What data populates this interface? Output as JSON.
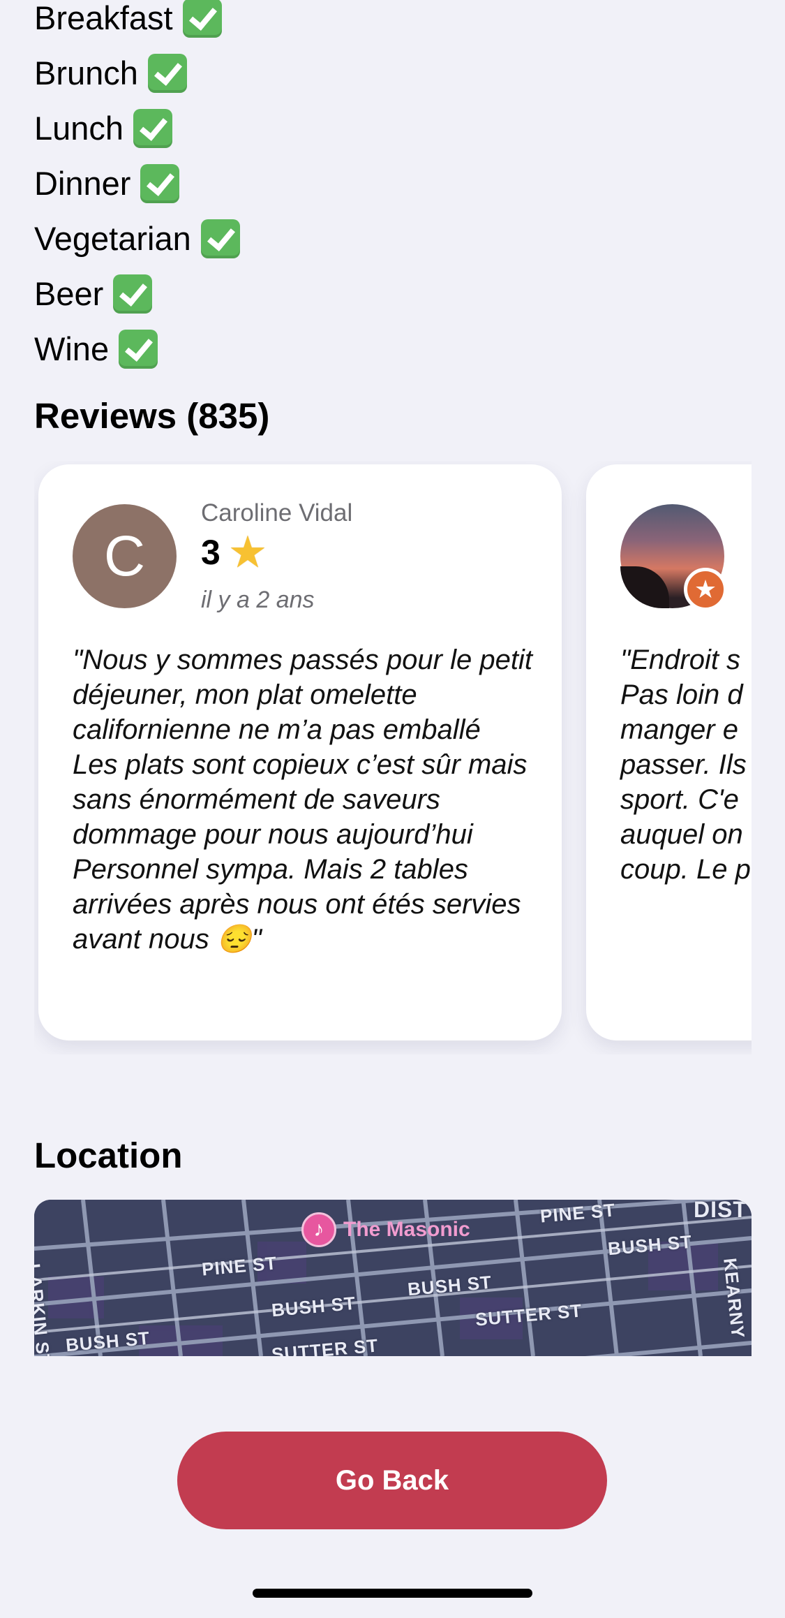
{
  "features": [
    {
      "label": "Breakfast",
      "icon": "check-mark-icon"
    },
    {
      "label": "Brunch",
      "icon": "check-mark-icon"
    },
    {
      "label": "Lunch",
      "icon": "check-mark-icon"
    },
    {
      "label": "Dinner",
      "icon": "check-mark-icon"
    },
    {
      "label": "Vegetarian",
      "icon": "check-mark-icon"
    },
    {
      "label": "Beer",
      "icon": "check-mark-icon"
    },
    {
      "label": "Wine",
      "icon": "check-mark-icon"
    }
  ],
  "reviews": {
    "heading": "Reviews (835)",
    "items": [
      {
        "avatar_letter": "C",
        "author": "Caroline Vidal",
        "rating": "3",
        "time": "il y a 2 ans",
        "text": "\"Nous y sommes passés pour le petit déjeuner, mon plat omelette californienne ne m’a pas emballé\nLes plats sont copieux c’est sûr mais sans énormément de saveurs dommage pour nous aujourd’hui\nPersonnel sympa. Mais 2 tables arrivées après nous ont étés servies avant nous 😔\""
      },
      {
        "author": "",
        "text": "\"Endroit s\nPas loin d\nmanger e\npasser. Ils\nsport. C'e\nauquel on\ncoup. Le p"
      }
    ]
  },
  "location": {
    "heading": "Location",
    "map": {
      "poi": "The Masonic",
      "streets": [
        "LARKIN ST",
        "PINE ST",
        "BUSH ST",
        "BUSH ST",
        "BUSH ST",
        "PINE ST",
        "BUSH ST",
        "SUTTER ST",
        "SUTTER ST",
        "KEARNY",
        "DIST",
        "BUSH ST"
      ]
    }
  },
  "actions": {
    "go_back": "Go Back"
  },
  "colors": {
    "background": "#f1f1f8",
    "accent": "#c23c50",
    "card": "#ffffff",
    "map": "#3f4563"
  }
}
